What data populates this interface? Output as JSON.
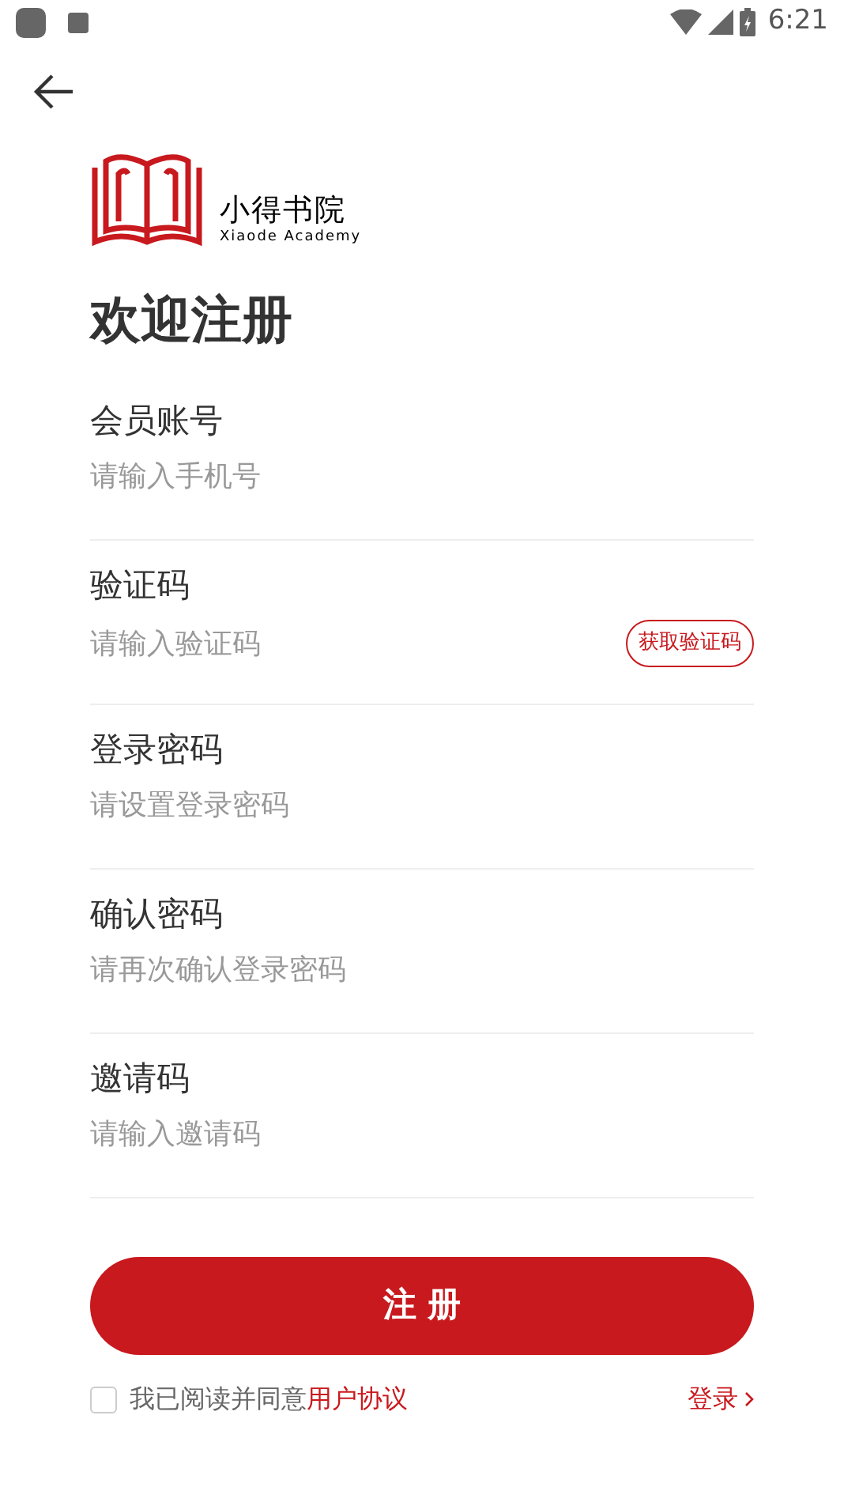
{
  "status_bar": {
    "time": "6:21"
  },
  "logo": {
    "name": "小得书院",
    "subtitle": "Xiaode Academy"
  },
  "title": "欢迎注册",
  "fields": [
    {
      "kind": "plain",
      "label": "会员账号",
      "placeholder": "请输入手机号"
    },
    {
      "kind": "with_button",
      "label": "验证码",
      "placeholder": "请输入验证码",
      "button": "获取验证码"
    },
    {
      "kind": "plain",
      "label": "登录密码",
      "placeholder": "请设置登录密码"
    },
    {
      "kind": "plain",
      "label": "确认密码",
      "placeholder": "请再次确认登录密码"
    },
    {
      "kind": "plain",
      "label": "邀请码",
      "placeholder": "请输入邀请码"
    }
  ],
  "submit": "注 册",
  "agreement": {
    "checked": false,
    "text": "我已阅读并同意",
    "link": "用户协议"
  },
  "login_link": "登录"
}
